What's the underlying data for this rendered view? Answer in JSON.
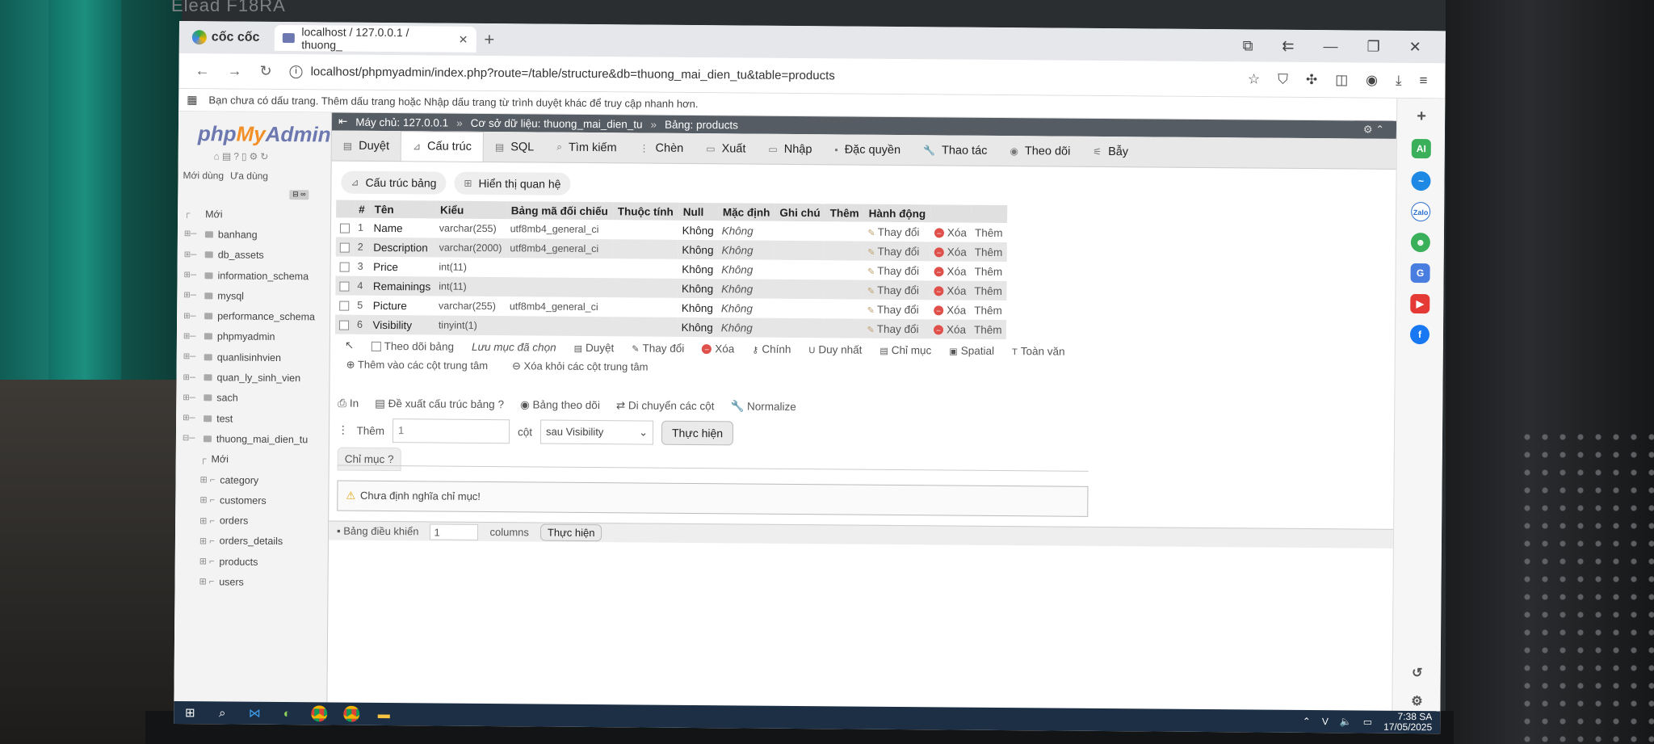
{
  "monitor": {
    "brand": "Elead F18RA"
  },
  "browser": {
    "brand": "cốc cốc",
    "tab_title": "localhost / 127.0.0.1 / thuong_",
    "url": "localhost/phpmyadmin/index.php?route=/table/structure&db=thuong_mai_dien_tu&table=products",
    "bookmarks_msg": "Bạn chưa có dấu trang. Thêm dấu trang hoặc Nhập dấu trang từ trình duyệt khác để truy cập nhanh hơn."
  },
  "sidebar": {
    "logo_php": "php",
    "logo_my": "My",
    "logo_admin": "Admin",
    "recent": "Mới dùng",
    "favorites": "Ưa dùng",
    "new_label": "Mới",
    "databases": [
      "banhang",
      "db_assets",
      "information_schema",
      "mysql",
      "performance_schema",
      "phpmyadmin",
      "quanlisinhvien",
      "quan_ly_sinh_vien",
      "sach",
      "test",
      "thuong_mai_dien_tu"
    ],
    "sub_new": "Mới",
    "tables": [
      "category",
      "customers",
      "orders",
      "orders_details",
      "products",
      "users"
    ]
  },
  "breadcrumb": {
    "server": "Máy chủ: 127.0.0.1",
    "database": "Cơ sở dữ liệu: thuong_mai_dien_tu",
    "table": "Bảng: products"
  },
  "tabs": [
    "Duyệt",
    "Cấu trúc",
    "SQL",
    "Tìm kiếm",
    "Chèn",
    "Xuất",
    "Nhập",
    "Đặc quyền",
    "Thao tác",
    "Theo dõi",
    "Bẫy"
  ],
  "subtabs": [
    "Cấu trúc bảng",
    "Hiển thị quan hệ"
  ],
  "table": {
    "headers": [
      "#",
      "Tên",
      "Kiểu",
      "Bảng mã đối chiếu",
      "Thuộc tính",
      "Null",
      "Mặc định",
      "Ghi chú",
      "Thêm",
      "Hành động"
    ],
    "rows": [
      {
        "num": "1",
        "name": "Name",
        "type": "varchar(255)",
        "collation": "utf8mb4_general_ci",
        "null": "Không",
        "default": "Không"
      },
      {
        "num": "2",
        "name": "Description",
        "type": "varchar(2000)",
        "collation": "utf8mb4_general_ci",
        "null": "Không",
        "default": "Không"
      },
      {
        "num": "3",
        "name": "Price",
        "type": "int(11)",
        "collation": "",
        "null": "Không",
        "default": "Không"
      },
      {
        "num": "4",
        "name": "Remainings",
        "type": "int(11)",
        "collation": "",
        "null": "Không",
        "default": "Không"
      },
      {
        "num": "5",
        "name": "Picture",
        "type": "varchar(255)",
        "collation": "utf8mb4_general_ci",
        "null": "Không",
        "default": "Không"
      },
      {
        "num": "6",
        "name": "Visibility",
        "type": "tinyint(1)",
        "collation": "",
        "null": "Không",
        "default": "Không"
      }
    ],
    "action_edit": "Thay đổi",
    "action_delete": "Xóa",
    "action_more": "Thêm"
  },
  "bulk": {
    "check_all": "Theo dõi bảng",
    "with_selected": "Lưu mục đã chọn",
    "actions": [
      "Duyệt",
      "Thay đổi",
      "Xóa",
      "Chính",
      "Duy nhất",
      "Chỉ mục",
      "Spatial",
      "Toàn văn"
    ],
    "add_central": "Thêm vào các cột trung tâm",
    "remove_central": "Xóa khỏi các cột trung tâm"
  },
  "tools": {
    "print": "In",
    "propose": "Đề xuất cấu trúc bảng",
    "track": "Bảng theo dõi",
    "move_cols": "Di chuyển các cột",
    "normalize": "Normalize"
  },
  "add_column": {
    "label": "Thêm",
    "count": "1",
    "col_label": "cột",
    "position": "sau Visibility",
    "go": "Thực hiện"
  },
  "indexes": {
    "title": "Chỉ mục",
    "notice": "Chưa định nghĩa chỉ mục!"
  },
  "console": {
    "label": "Bảng điều khiển",
    "count": "1",
    "columns": "columns",
    "go": "Thực hiện"
  },
  "taskbar": {
    "time": "7:38 SA",
    "date": "17/05/2025"
  }
}
